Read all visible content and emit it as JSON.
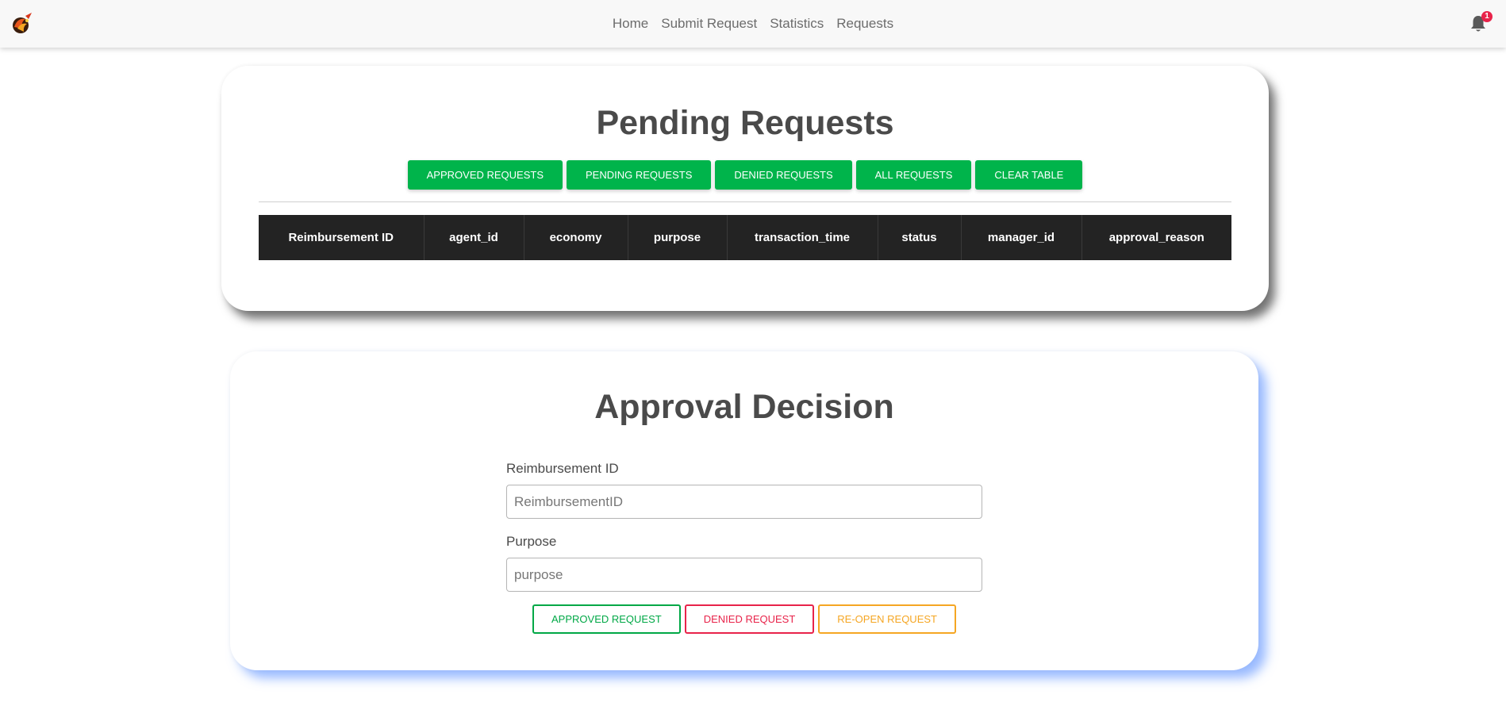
{
  "nav": {
    "links": [
      "Home",
      "Submit Request",
      "Statistics",
      "Requests"
    ],
    "notification_count": "1",
    "brand_icon": "phoenix-logo",
    "bell_icon": "bell-icon"
  },
  "pending": {
    "title": "Pending Requests",
    "filters": [
      "Approved Requests",
      "Pending Requests",
      "Denied Requests",
      "All Requests",
      "Clear Table"
    ],
    "table": {
      "headers": [
        "Reimbursement ID",
        "agent_id",
        "economy",
        "purpose",
        "transaction_time",
        "status",
        "manager_id",
        "approval_reason"
      ],
      "rows": []
    }
  },
  "approval": {
    "title": "Approval Decision",
    "reimbursement_label": "Reimbursement ID",
    "reimbursement_placeholder": "ReimbursementID",
    "reimbursement_value": "",
    "purpose_label": "Purpose",
    "purpose_placeholder": "purpose",
    "purpose_value": "",
    "buttons": {
      "approve": "Approved Request",
      "deny": "Denied Request",
      "reopen": "Re-Open Request"
    }
  },
  "colors": {
    "accent_green": "#00b44b",
    "approve": "#00a846",
    "deny": "#e8234a",
    "reopen": "#f5a623",
    "table_header": "#232323",
    "badge": "#e8234a"
  }
}
